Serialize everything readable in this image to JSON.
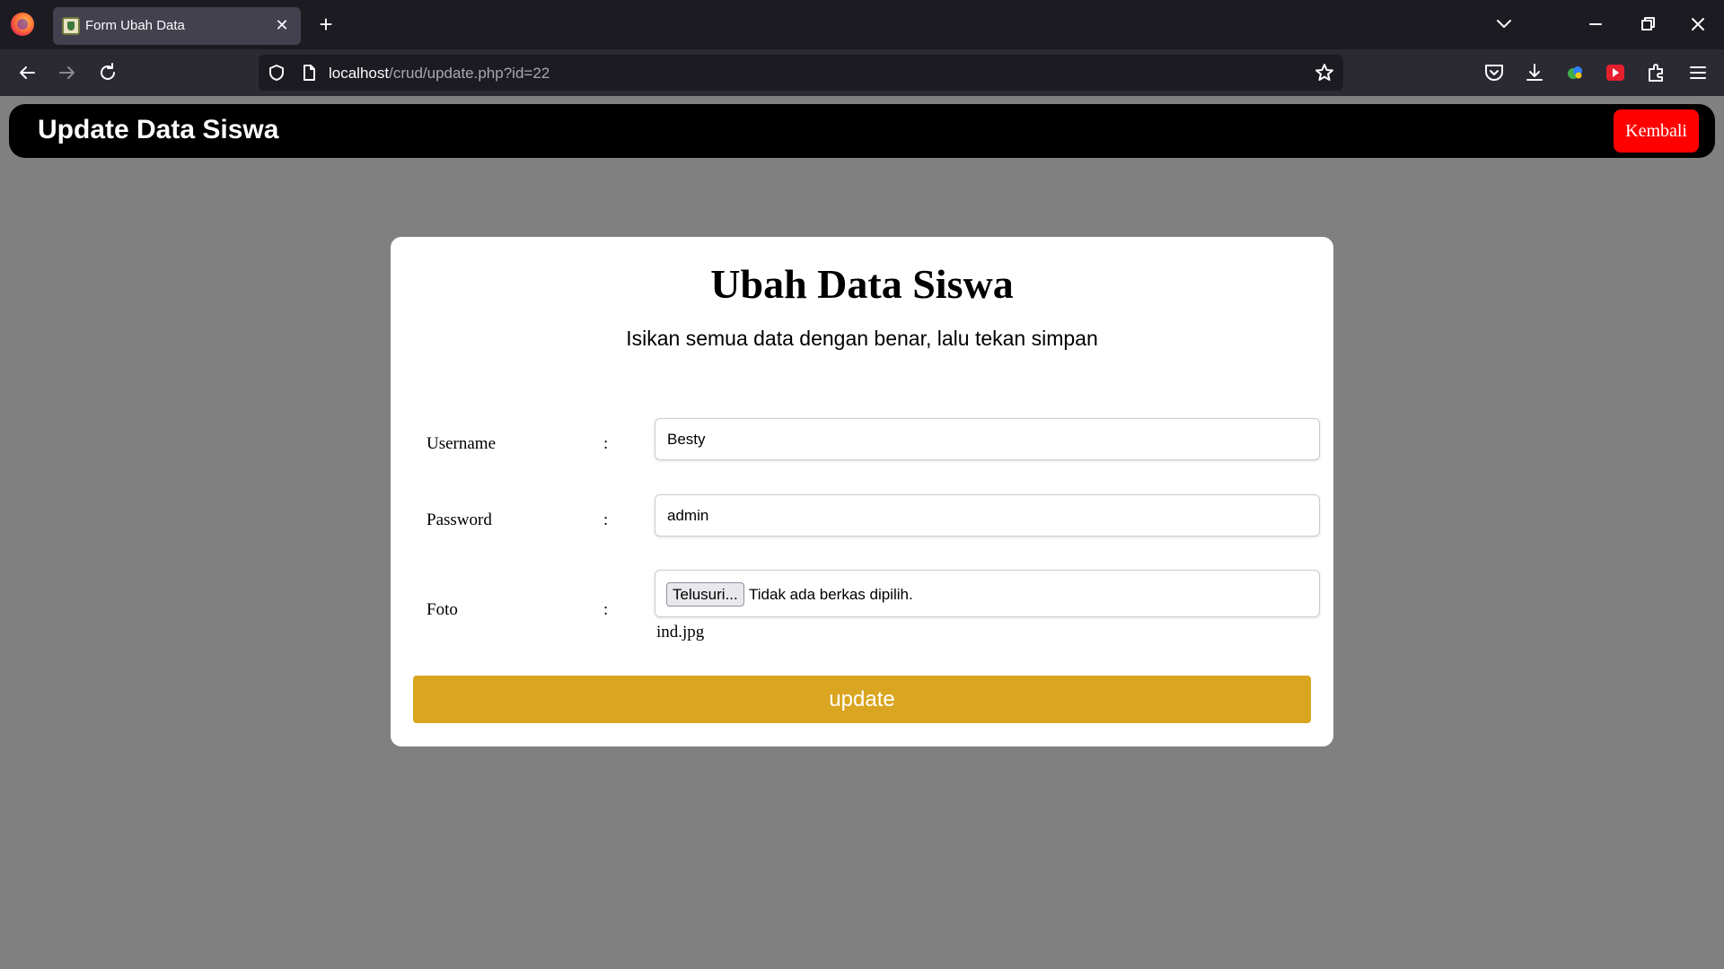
{
  "browser": {
    "tab_title": "Form Ubah Data",
    "url_host": "localhost",
    "url_path": "/crud/update.php?id=22"
  },
  "header": {
    "title": "Update Data Siswa",
    "back_label": "Kembali"
  },
  "form": {
    "title": "Ubah Data Siswa",
    "subtitle": "Isikan semua data dengan benar, lalu tekan simpan",
    "username_label": "Username",
    "username_value": "Besty",
    "password_label": "Password",
    "password_value": "admin",
    "photo_label": "Foto",
    "colon": ":",
    "file_button_label": "Telusuri...",
    "file_status": "Tidak ada berkas dipilih.",
    "current_file": "ind.jpg",
    "submit_label": "update"
  },
  "colors": {
    "submit": "#daa520",
    "back_button": "#ff0000",
    "page_bg": "#808080"
  }
}
